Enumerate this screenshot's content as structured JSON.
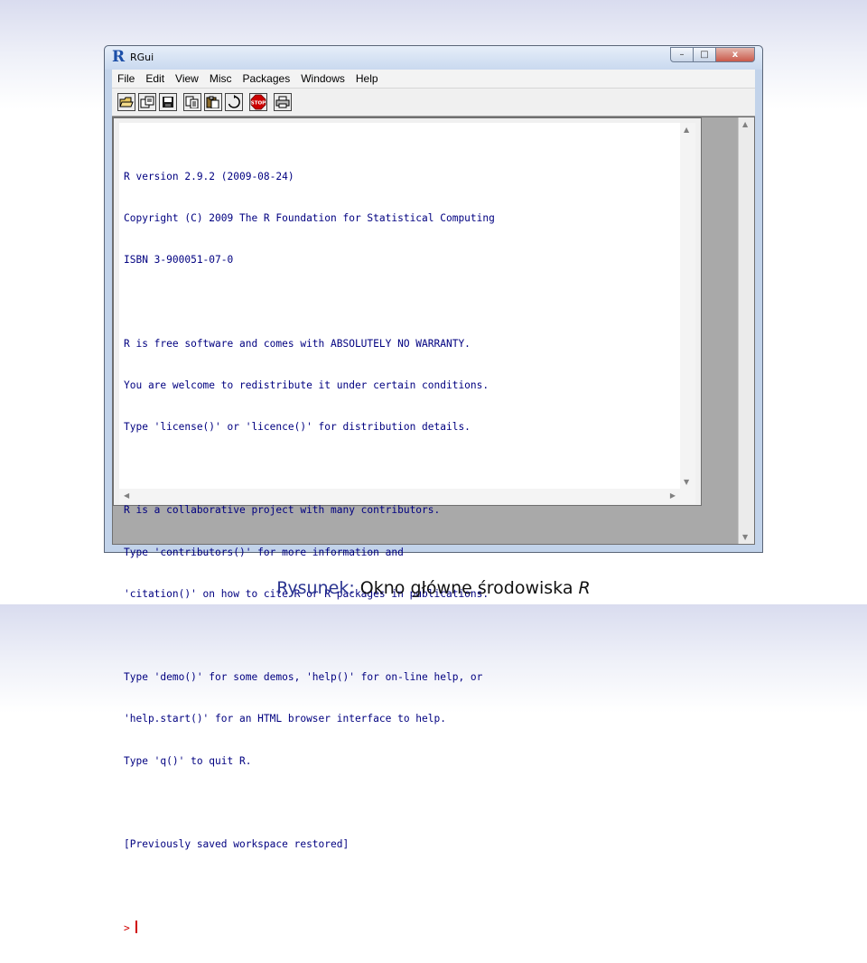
{
  "window": {
    "title": "RGui",
    "controls": {
      "minimize": "–",
      "maximize": "□",
      "close": "x"
    }
  },
  "menu": [
    "File",
    "Edit",
    "View",
    "Misc",
    "Packages",
    "Windows",
    "Help"
  ],
  "toolbar": {
    "buttons": [
      {
        "name": "open-script-icon"
      },
      {
        "name": "load-workspace-icon"
      },
      {
        "name": "save-workspace-icon"
      },
      {
        "name": "copy-icon"
      },
      {
        "name": "paste-icon"
      },
      {
        "name": "copy-paste-icon"
      },
      {
        "name": "stop-icon",
        "label": "STOP",
        "color": "#cc0000"
      },
      {
        "name": "print-icon"
      }
    ]
  },
  "console": {
    "lines": [
      "R version 2.9.2 (2009-08-24)",
      "Copyright (C) 2009 The R Foundation for Statistical Computing",
      "ISBN 3-900051-07-0",
      "",
      "R is free software and comes with ABSOLUTELY NO WARRANTY.",
      "You are welcome to redistribute it under certain conditions.",
      "Type 'license()' or 'licence()' for distribution details.",
      "",
      "R is a collaborative project with many contributors.",
      "Type 'contributors()' for more information and",
      "'citation()' on how to cite R or R packages in publications.",
      "",
      "Type 'demo()' for some demos, 'help()' for on-line help, or",
      "'help.start()' for an HTML browser interface to help.",
      "Type 'q()' to quit R.",
      "",
      "[Previously saved workspace restored]",
      ""
    ],
    "prompt": "> ",
    "text_color": "#000080",
    "prompt_color": "#d00000"
  },
  "caption": {
    "label": "Rysunek:",
    "text": "Okno główne środowiska",
    "app": "R",
    "label_color": "#2b3590"
  }
}
